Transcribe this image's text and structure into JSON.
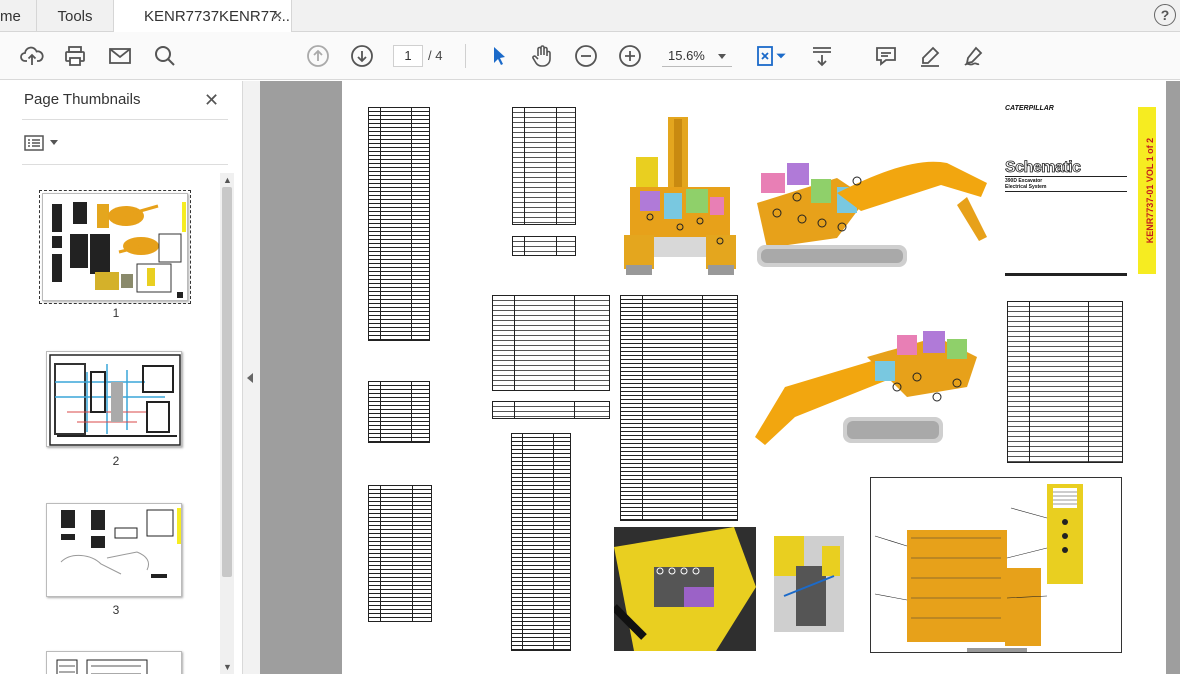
{
  "tabs": {
    "home_label": "me",
    "tools_label": "Tools",
    "doc_label": "KENR7737KENR77...",
    "close_glyph": "✕",
    "help_glyph": "?"
  },
  "toolbar": {
    "current_page": "1",
    "page_total": "/ 4",
    "zoom": "15.6%",
    "icons": [
      "upload-icon",
      "print-icon",
      "email-icon",
      "search-icon",
      "page-up-icon",
      "page-down-icon",
      "select-cursor-icon",
      "hand-icon",
      "zoom-out-icon",
      "zoom-in-icon",
      "fit-page-icon",
      "scroll-mode-icon",
      "comment-icon",
      "highlight-pen-icon",
      "sign-icon"
    ]
  },
  "sidebar": {
    "title": "Page Thumbnails",
    "close_glyph": "✕",
    "thumbnails": [
      {
        "label": "1"
      },
      {
        "label": "2"
      },
      {
        "label": "3"
      }
    ]
  },
  "document": {
    "brand": "CATERPILLAR",
    "title": "Schematic",
    "subtitle_1": "390D Excavator",
    "subtitle_2": "Electrical System",
    "vertical_title": "KENR7737-01 VOL 1 of 2",
    "colors": {
      "cat_yellow": "#f1c40f",
      "band_yellow": "#f6ec21",
      "band_text": "#c51d1d",
      "background_gray": "#9e9e9e"
    }
  }
}
